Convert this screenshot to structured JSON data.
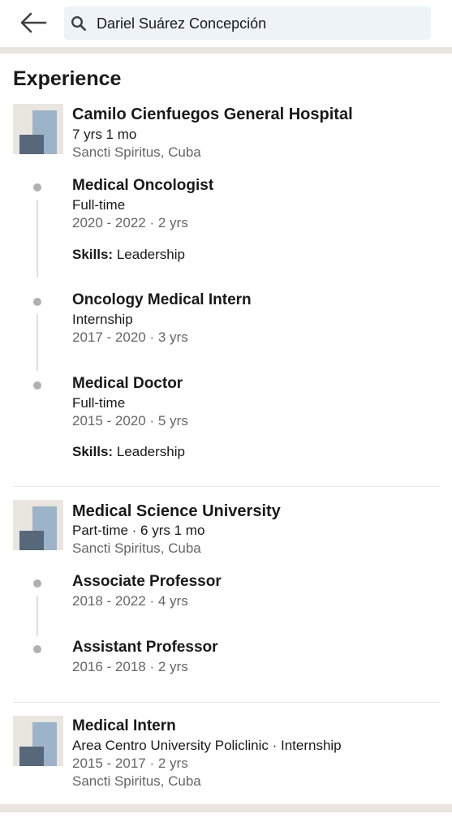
{
  "header": {
    "search_value": "Dariel Suárez Concepción"
  },
  "section": {
    "title": "Experience"
  },
  "experience": [
    {
      "company": "Camilo Cienfuegos General Hospital",
      "duration": "7 yrs 1 mo",
      "location": "Sancti Spiritus, Cuba",
      "roles": [
        {
          "title": "Medical Oncologist",
          "type": "Full-time",
          "dates": "2020 - 2022 · 2 yrs",
          "skills_label": "Skills:",
          "skills": "Leadership"
        },
        {
          "title": "Oncology Medical Intern",
          "type": "Internship",
          "dates": "2017 - 2020 · 3 yrs"
        },
        {
          "title": "Medical Doctor",
          "type": "Full-time",
          "dates": "2015 - 2020 · 5 yrs",
          "skills_label": "Skills:",
          "skills": "Leadership"
        }
      ]
    },
    {
      "company": "Medical Science University",
      "duration": "Part-time · 6 yrs 1 mo",
      "location": "Sancti Spiritus, Cuba",
      "roles": [
        {
          "title": "Associate Professor",
          "dates": "2018 - 2022 · 4 yrs"
        },
        {
          "title": "Assistant Professor",
          "dates": "2016 - 2018 · 2 yrs"
        }
      ]
    },
    {
      "title": "Medical Intern",
      "subtitle": "Area Centro University Policlinic · Internship",
      "dates": "2015 - 2017 · 2 yrs",
      "location": "Sancti Spiritus, Cuba"
    }
  ],
  "icons": {
    "back": "arrow-left-icon",
    "search": "search-icon",
    "company_logo": "company-logo-placeholder"
  },
  "colors": {
    "search_bg": "#eef3f8",
    "section_band": "#e9e5df",
    "logo_light": "#9db3c8",
    "logo_dark": "#56687a",
    "secondary_text": "#666666"
  }
}
